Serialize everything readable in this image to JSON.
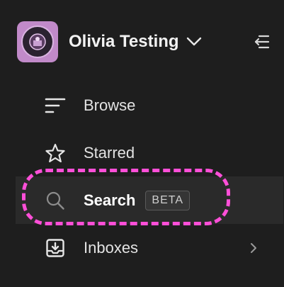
{
  "workspace": {
    "name": "Olivia Testing"
  },
  "nav": {
    "items": [
      {
        "label": "Browse",
        "icon": "browse-lines-icon"
      },
      {
        "label": "Starred",
        "icon": "star-icon"
      },
      {
        "label": "Search",
        "icon": "search-icon",
        "badge": "BETA",
        "active": true
      },
      {
        "label": "Inboxes",
        "icon": "inbox-icon"
      }
    ]
  },
  "colors": {
    "background": "#1e1e1e",
    "active_row": "#2a2a2a",
    "highlight": "#ff4fd8",
    "avatar_bg": "#c18ac9"
  }
}
